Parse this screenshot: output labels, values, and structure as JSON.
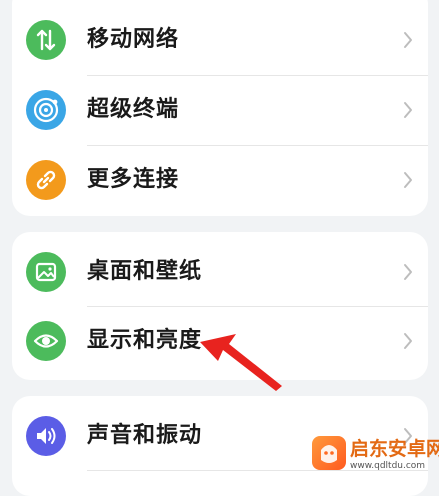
{
  "groups": [
    {
      "items": [
        {
          "label": "移动网络",
          "icon": "mobile-network-icon",
          "color": "#4cbb5c"
        },
        {
          "label": "超级终端",
          "icon": "super-device-icon",
          "color": "#3aa6e6"
        },
        {
          "label": "更多连接",
          "icon": "link-icon",
          "color": "#f39a1c"
        }
      ]
    },
    {
      "items": [
        {
          "label": "桌面和壁纸",
          "icon": "wallpaper-icon",
          "color": "#4cbb5c"
        },
        {
          "label": "显示和亮度",
          "icon": "eye-icon",
          "color": "#4cbb5c"
        }
      ]
    },
    {
      "items": [
        {
          "label": "声音和振动",
          "icon": "speaker-icon",
          "color": "#5b5de6"
        }
      ]
    }
  ],
  "watermark": {
    "title": "启东安卓网",
    "url": "www.qdltdu.com"
  },
  "colors": {
    "background": "#f1f3f5",
    "card": "#ffffff",
    "annotation_arrow": "#e8231f"
  }
}
